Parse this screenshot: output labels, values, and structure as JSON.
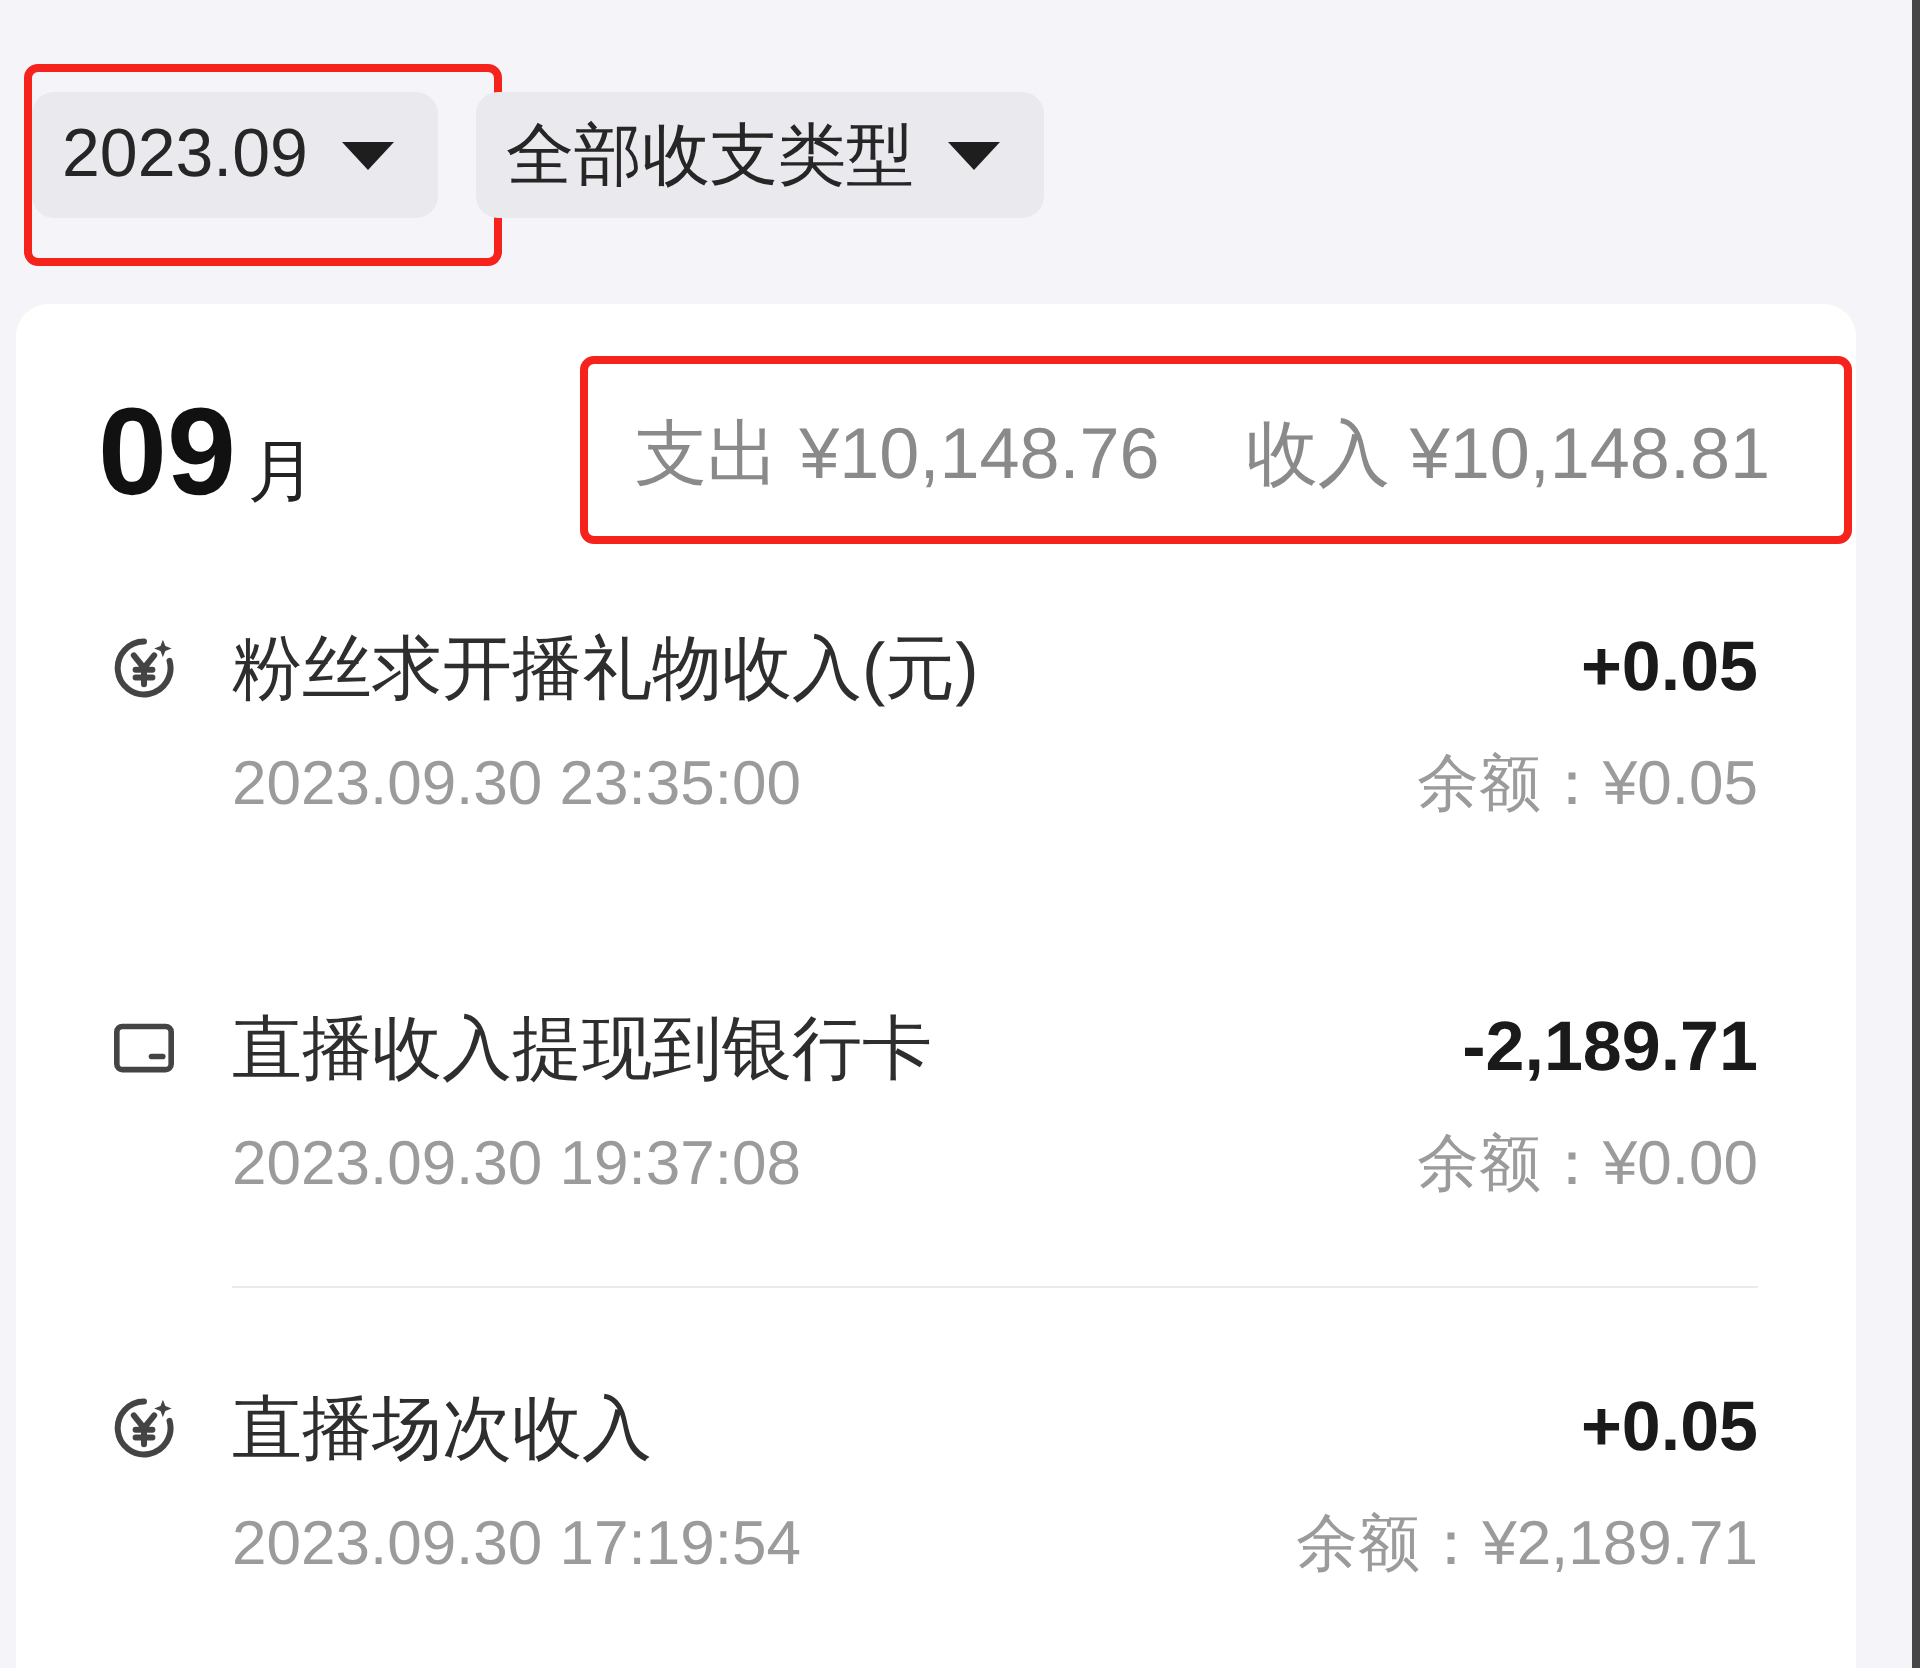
{
  "filters": [
    {
      "label": "2023.09",
      "highlighted": true
    },
    {
      "label": "全部收支类型",
      "highlighted": false
    }
  ],
  "month": {
    "number": "09",
    "unit": "月"
  },
  "summary": {
    "highlighted": true,
    "items": [
      "支出 ¥10,148.76",
      "收入 ¥10,148.81"
    ]
  },
  "transactions": [
    {
      "kind": "income",
      "title": "粉丝求开播礼物收入(元)",
      "amount": "+0.05",
      "time": "2023.09.30 23:35:00",
      "balance": "余额：¥0.05",
      "separator": false
    },
    {
      "kind": "withdrawal",
      "title": "直播收入提现到银行卡",
      "amount": "-2,189.71",
      "time": "2023.09.30 19:37:08",
      "balance": "余额：¥0.00",
      "separator": true
    },
    {
      "kind": "income",
      "title": "直播场次收入",
      "amount": "+0.05",
      "time": "2023.09.30 17:19:54",
      "balance": "余额：¥2,189.71",
      "separator": false
    }
  ]
}
